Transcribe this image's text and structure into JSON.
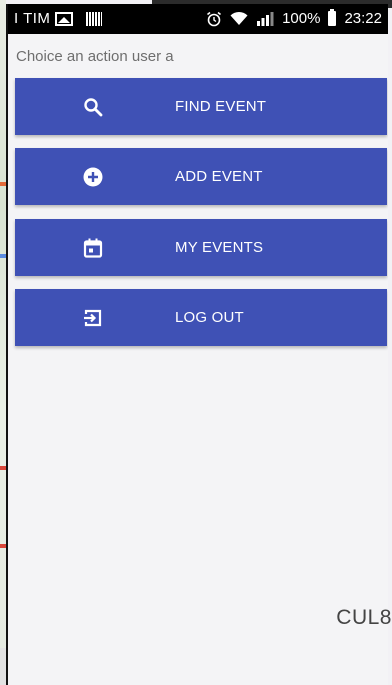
{
  "status_bar": {
    "carrier": "I TIM",
    "battery_percent": "100%",
    "time": "23:22",
    "icons": [
      "photo-icon",
      "barcode-icon",
      "alarm-icon",
      "wifi-icon",
      "signal-icon",
      "battery-icon"
    ]
  },
  "page": {
    "title": "Choice an action user a"
  },
  "actions": [
    {
      "label": "FIND EVENT",
      "icon": "search-icon"
    },
    {
      "label": "ADD EVENT",
      "icon": "add-circle-icon"
    },
    {
      "label": "MY EVENTS",
      "icon": "calendar-icon"
    },
    {
      "label": "LOG OUT",
      "icon": "logout-icon"
    }
  ],
  "background": {
    "cut_text": "CUL8"
  },
  "colors": {
    "button_bg": "#3f51b5",
    "button_text": "#ffffff",
    "status_bar_bg": "#000000",
    "screen_bg": "#f4f4f6",
    "title_text": "#6e6e6e"
  }
}
